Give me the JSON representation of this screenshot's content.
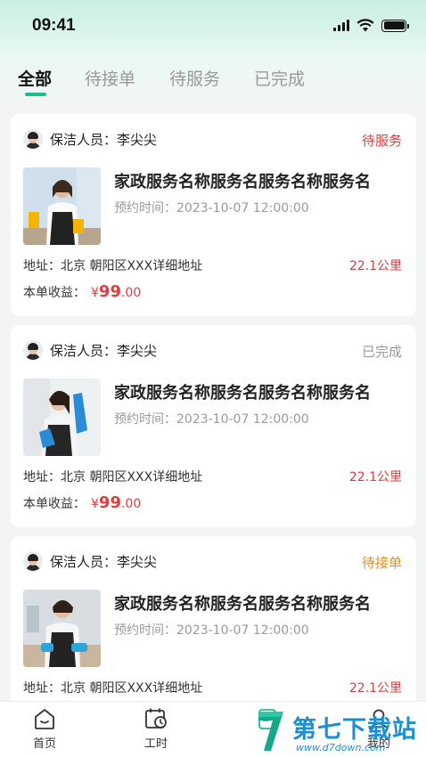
{
  "status_bar": {
    "time": "09:41"
  },
  "tabs": [
    {
      "label": "全部",
      "active": true
    },
    {
      "label": "待接单",
      "active": false
    },
    {
      "label": "待服务",
      "active": false
    },
    {
      "label": "已完成",
      "active": false
    }
  ],
  "orders": [
    {
      "cleaner_label": "保洁人员：李尖尖",
      "status": "待服务",
      "status_color": "#e23b3b",
      "service_name": "家政服务名称服务名服务名称服务名",
      "appointment": "预约时间：2023-10-07 12:00:00",
      "address": "地址：北京 朝阳区XXX详细地址",
      "distance": "22.1公里",
      "earnings_label": "本单收益：",
      "earnings_currency": "¥",
      "earnings_int": "99",
      "earnings_dec": ".00"
    },
    {
      "cleaner_label": "保洁人员：李尖尖",
      "status": "已完成",
      "status_color": "#9a9a9a",
      "service_name": "家政服务名称服务名服务名称服务名",
      "appointment": "预约时间：2023-10-07 12:00:00",
      "address": "地址：北京 朝阳区XXX详细地址",
      "distance": "22.1公里",
      "earnings_label": "本单收益：",
      "earnings_currency": "¥",
      "earnings_int": "99",
      "earnings_dec": ".00"
    },
    {
      "cleaner_label": "保洁人员：李尖尖",
      "status": "待接单",
      "status_color": "#f08a1c",
      "service_name": "家政服务名称服务名服务名称服务名",
      "appointment": "预约时间：2023-10-07 12:00:00",
      "address": "地址：北京 朝阳区XXX详细地址",
      "distance": "22.1公里"
    }
  ],
  "tabbar": [
    {
      "label": "首页",
      "icon": "home-icon"
    },
    {
      "label": "工时",
      "icon": "calendar-clock-icon"
    },
    {
      "label": "",
      "icon": "orders-icon"
    },
    {
      "label": "我的",
      "icon": "profile-icon"
    }
  ],
  "watermark": {
    "brand": "第七下载站",
    "url": "www.d7down.com"
  },
  "colors": {
    "accent": "#1bbf8f",
    "price": "#e23b3b",
    "pending": "#f08a1c",
    "done": "#9a9a9a"
  }
}
